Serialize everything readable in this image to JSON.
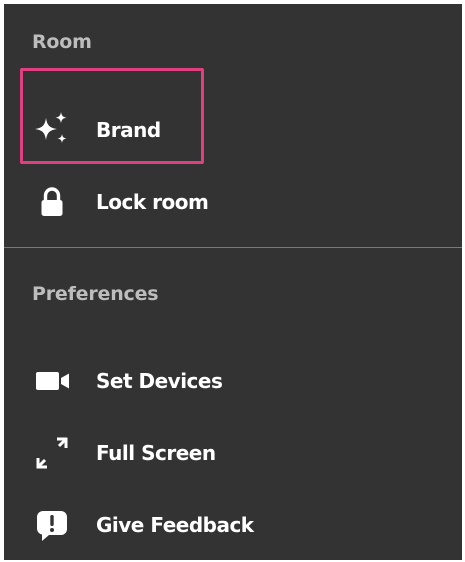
{
  "room_section": {
    "title": "Room",
    "items": [
      {
        "label": "Brand",
        "icon": "sparkle-icon"
      },
      {
        "label": "Lock room",
        "icon": "lock-icon"
      }
    ]
  },
  "preferences_section": {
    "title": "Preferences",
    "items": [
      {
        "label": "Set Devices",
        "icon": "video-camera-icon"
      },
      {
        "label": "Full Screen",
        "icon": "fullscreen-icon"
      },
      {
        "label": "Give Feedback",
        "icon": "feedback-icon"
      }
    ]
  },
  "colors": {
    "panel_background": "#333333",
    "section_title": "#bdbdbd",
    "item_text": "#ffffff",
    "highlight_border": "#e0407f",
    "divider": "#7a7a7a"
  }
}
